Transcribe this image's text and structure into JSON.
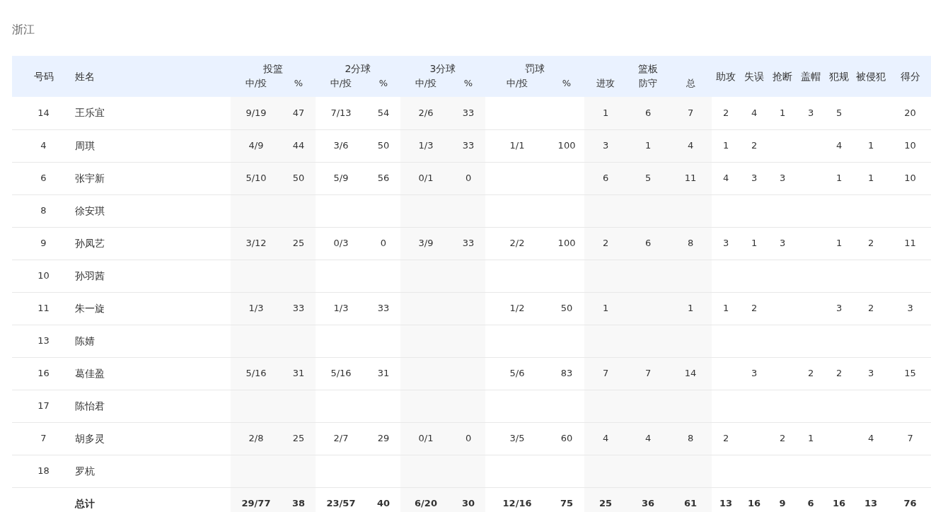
{
  "team": "浙江",
  "columns": [
    {
      "label": "号码"
    },
    {
      "label": "姓名"
    },
    {
      "label": "投篮",
      "sub": [
        "中/投",
        "%"
      ]
    },
    {
      "label": "2分球",
      "sub": [
        "中/投",
        "%"
      ]
    },
    {
      "label": "3分球",
      "sub": [
        "中/投",
        "%"
      ]
    },
    {
      "label": "罚球",
      "sub": [
        "中/投",
        "%"
      ]
    },
    {
      "label": "篮板",
      "sub": [
        "进攻",
        "防守",
        "总"
      ]
    },
    {
      "label": "助攻"
    },
    {
      "label": "失误"
    },
    {
      "label": "抢断"
    },
    {
      "label": "盖帽"
    },
    {
      "label": "犯规"
    },
    {
      "label": "被侵犯"
    },
    {
      "label": "得分"
    }
  ],
  "rows": [
    {
      "kind": "player",
      "cells": [
        "14",
        "王乐宜",
        "9/19",
        "47",
        "7/13",
        "54",
        "2/6",
        "33",
        null,
        null,
        "1",
        "6",
        "7",
        "2",
        "4",
        "1",
        "3",
        "5",
        null,
        "20"
      ]
    },
    {
      "kind": "player",
      "cells": [
        "4",
        "周琪",
        "4/9",
        "44",
        "3/6",
        "50",
        "1/3",
        "33",
        "1/1",
        "100",
        "3",
        "1",
        "4",
        "1",
        "2",
        null,
        null,
        "4",
        "1",
        "10"
      ]
    },
    {
      "kind": "player",
      "cells": [
        "6",
        "张宇新",
        "5/10",
        "50",
        "5/9",
        "56",
        "0/1",
        "0",
        null,
        null,
        "6",
        "5",
        "11",
        "4",
        "3",
        "3",
        null,
        "1",
        "1",
        "10"
      ]
    },
    {
      "kind": "player",
      "cells": [
        "8",
        "徐安琪",
        null,
        null,
        null,
        null,
        null,
        null,
        null,
        null,
        null,
        null,
        null,
        null,
        null,
        null,
        null,
        null,
        null,
        null
      ]
    },
    {
      "kind": "player",
      "cells": [
        "9",
        "孙凤艺",
        "3/12",
        "25",
        "0/3",
        "0",
        "3/9",
        "33",
        "2/2",
        "100",
        "2",
        "6",
        "8",
        "3",
        "1",
        "3",
        null,
        "1",
        "2",
        "11"
      ]
    },
    {
      "kind": "player",
      "cells": [
        "10",
        "孙羽茜",
        null,
        null,
        null,
        null,
        null,
        null,
        null,
        null,
        null,
        null,
        null,
        null,
        null,
        null,
        null,
        null,
        null,
        null
      ]
    },
    {
      "kind": "player",
      "cells": [
        "11",
        "朱一旋",
        "1/3",
        "33",
        "1/3",
        "33",
        null,
        null,
        "1/2",
        "50",
        "1",
        null,
        "1",
        "1",
        "2",
        null,
        null,
        "3",
        "2",
        "3"
      ]
    },
    {
      "kind": "player",
      "cells": [
        "13",
        "陈婧",
        null,
        null,
        null,
        null,
        null,
        null,
        null,
        null,
        null,
        null,
        null,
        null,
        null,
        null,
        null,
        null,
        null,
        null
      ]
    },
    {
      "kind": "player",
      "cells": [
        "16",
        "葛佳盈",
        "5/16",
        "31",
        "5/16",
        "31",
        null,
        null,
        "5/6",
        "83",
        "7",
        "7",
        "14",
        null,
        "3",
        null,
        "2",
        "2",
        "3",
        "15"
      ]
    },
    {
      "kind": "player",
      "cells": [
        "17",
        "陈怡君",
        null,
        null,
        null,
        null,
        null,
        null,
        null,
        null,
        null,
        null,
        null,
        null,
        null,
        null,
        null,
        null,
        null,
        null
      ]
    },
    {
      "kind": "player",
      "cells": [
        "7",
        "胡多灵",
        "2/8",
        "25",
        "2/7",
        "29",
        "0/1",
        "0",
        "3/5",
        "60",
        "4",
        "4",
        "8",
        "2",
        null,
        "2",
        "1",
        null,
        "4",
        "7"
      ]
    },
    {
      "kind": "player",
      "cells": [
        "18",
        "罗杭",
        null,
        null,
        null,
        null,
        null,
        null,
        null,
        null,
        null,
        null,
        null,
        null,
        null,
        null,
        null,
        null,
        null,
        null
      ]
    },
    {
      "kind": "total",
      "cells": [
        null,
        "总计",
        "29/77",
        "38",
        "23/57",
        "40",
        "6/20",
        "30",
        "12/16",
        "75",
        "25",
        "36",
        "61",
        "13",
        "16",
        "9",
        "6",
        "16",
        "13",
        "76"
      ]
    }
  ]
}
